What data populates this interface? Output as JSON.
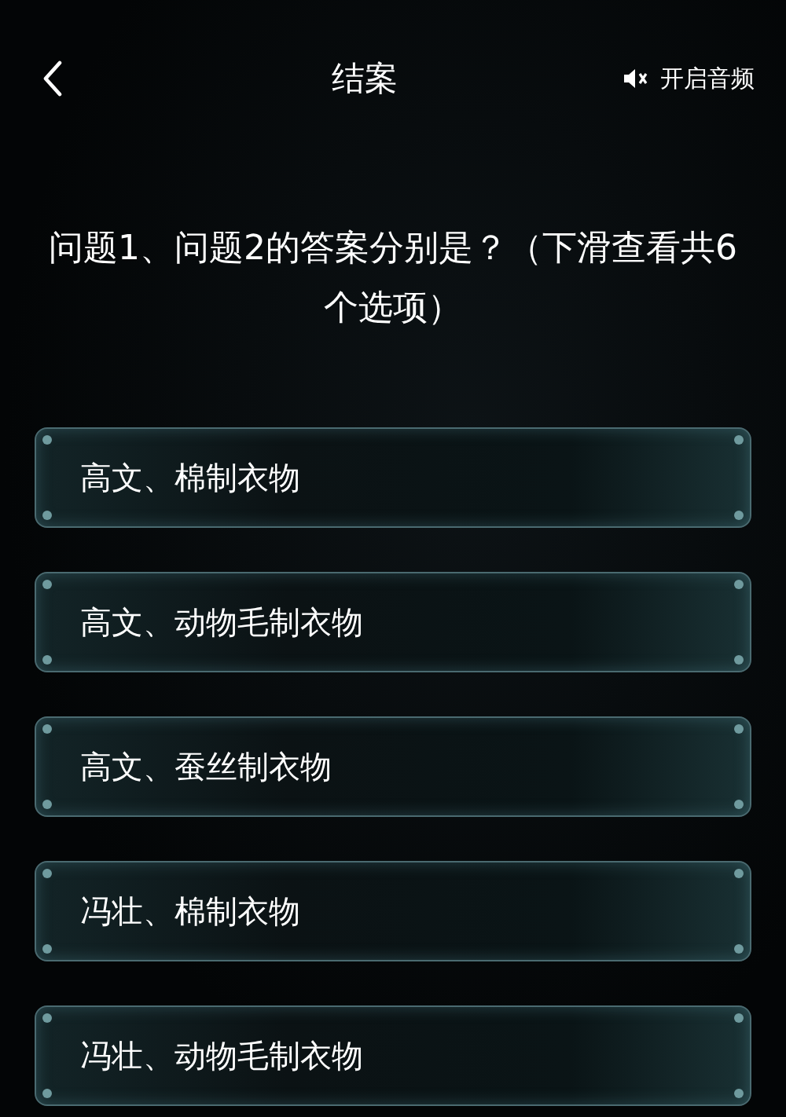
{
  "header": {
    "title": "结案",
    "audio_button": "开启音频"
  },
  "question": "问题1、问题2的答案分别是？（下滑查看共6个选项）",
  "options": [
    {
      "label": "高文、棉制衣物"
    },
    {
      "label": "高文、动物毛制衣物"
    },
    {
      "label": "高文、蚕丝制衣物"
    },
    {
      "label": "冯壮、棉制衣物"
    },
    {
      "label": "冯壮、动物毛制衣物"
    }
  ]
}
